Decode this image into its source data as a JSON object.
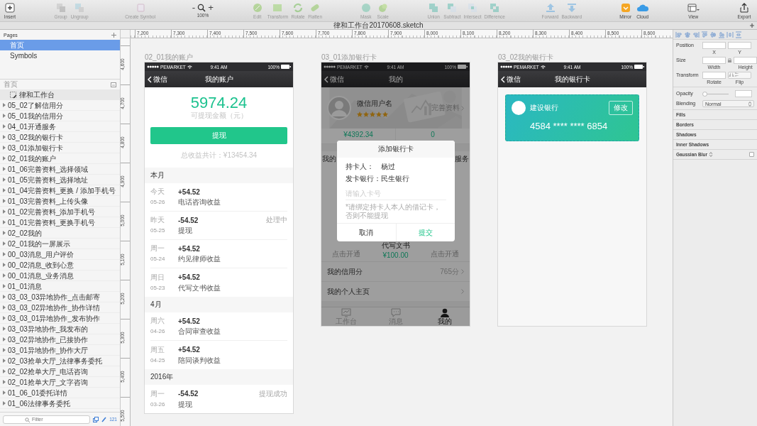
{
  "toolbar": {
    "groups": [
      {
        "items": [
          {
            "kind": "insert",
            "label": "Insert",
            "disabled": false
          }
        ]
      },
      {
        "items": [
          {
            "kind": "group",
            "label": "Group",
            "disabled": true
          },
          {
            "kind": "ungroup",
            "label": "Ungroup",
            "disabled": true
          }
        ]
      },
      {
        "items": [
          {
            "kind": "create-symbol",
            "label": "Create Symbol",
            "disabled": true
          }
        ]
      },
      {
        "items": [
          {
            "kind": "zoom",
            "label": "100%",
            "minus": "-",
            "plus": "+",
            "disabled": false
          }
        ]
      },
      {
        "items": [
          {
            "kind": "edit",
            "label": "Edit",
            "disabled": true
          },
          {
            "kind": "transform",
            "label": "Transform",
            "disabled": true
          },
          {
            "kind": "rotate",
            "label": "Rotate",
            "disabled": true
          },
          {
            "kind": "flatten",
            "label": "Flatten",
            "disabled": true
          }
        ]
      },
      {
        "items": [
          {
            "kind": "mask",
            "label": "Mask",
            "disabled": true
          },
          {
            "kind": "scale",
            "label": "Scale",
            "disabled": true
          }
        ]
      },
      {
        "items": [
          {
            "kind": "union",
            "label": "Union",
            "disabled": true
          },
          {
            "kind": "subtract",
            "label": "Subtract",
            "disabled": true
          },
          {
            "kind": "intersect",
            "label": "Intersect",
            "disabled": true
          },
          {
            "kind": "difference",
            "label": "Difference",
            "disabled": true
          }
        ]
      },
      {
        "items": [
          {
            "kind": "forward",
            "label": "Forward",
            "disabled": true
          },
          {
            "kind": "backward",
            "label": "Backward",
            "disabled": true
          }
        ]
      },
      {
        "items": [
          {
            "kind": "mirror",
            "label": "Mirror",
            "disabled": false
          },
          {
            "kind": "cloud",
            "label": "Cloud",
            "disabled": false
          }
        ]
      },
      {
        "items": [
          {
            "kind": "view",
            "label": "View",
            "disabled": false
          }
        ]
      },
      {
        "items": [
          {
            "kind": "export",
            "label": "Export",
            "disabled": false
          }
        ]
      }
    ]
  },
  "document_title": "律和工作台20170608.sketch",
  "rulers": {
    "horizontal": [
      "7,200",
      "7,300",
      "7,400",
      "7,500",
      "7,600",
      "7,700",
      "7,800",
      "7,900",
      "8,000",
      "8,100",
      "8,200",
      "8,300",
      "8,400",
      "8,500",
      "8,600"
    ],
    "vertical": [
      "4,600",
      "4,700",
      "4,800",
      "4,900",
      "5,000",
      "5,100",
      "5,200",
      "5,300",
      "5,400",
      "5,500"
    ]
  },
  "pages": {
    "title": "Pages",
    "items": [
      {
        "label": "首页",
        "selected": true
      },
      {
        "label": "Symbols",
        "selected": false
      }
    ]
  },
  "layers": {
    "page": "首页",
    "artboard_group": "律和工作台",
    "items": [
      {
        "label": "05_02了解信用分"
      },
      {
        "label": "05_01我的信用分"
      },
      {
        "label": "04_01开通服务"
      },
      {
        "label": "03_02我的银行卡"
      },
      {
        "label": "03_01添加银行卡"
      },
      {
        "label": "02_01我的账户"
      },
      {
        "label": "01_06完善资料_选择领域"
      },
      {
        "label": "01_05完善资料_选择地址"
      },
      {
        "label": "01_04完善资料_更换 / 添加手机号"
      },
      {
        "label": "01_03完善资料_上传头像"
      },
      {
        "label": "01_02完善资料_添加手机号"
      },
      {
        "label": "01_01完善资料_更换手机号"
      },
      {
        "label": "02_02我的"
      },
      {
        "label": "02_01我的一屏展示"
      },
      {
        "label": "00_03消息_用户评价"
      },
      {
        "label": "00_02消息_收到心意"
      },
      {
        "label": "00_01消息_业务消息"
      },
      {
        "label": "01_01消息"
      },
      {
        "label": "03_03_03异地协作_点击邮寄"
      },
      {
        "label": "03_03_02异地协作_协作详情"
      },
      {
        "label": "03_03_01异地协作_发布协作"
      },
      {
        "label": "03_03异地协作_我发布的"
      },
      {
        "label": "03_02异地协作_已接协作"
      },
      {
        "label": "03_01异地协作_协作大厅"
      },
      {
        "label": "02_03抢单大厅_法律事务委托"
      },
      {
        "label": "02_02抢单大厅_电话咨询"
      },
      {
        "label": "02_01抢单大厅_文字咨询"
      },
      {
        "label": "01_06_01委托详情"
      },
      {
        "label": "01_06法律事务委托"
      }
    ],
    "filter_placeholder": "Filter",
    "count": "121"
  },
  "artboards": [
    {
      "kind": "account",
      "label": "02_01我的账户",
      "status": {
        "carrier": "PEMARKET",
        "time": "9:41 AM",
        "battery": "100%"
      },
      "nav": {
        "back": "微信",
        "title": "我的账户"
      },
      "balance": "5974.24",
      "balance_caption": "可提现金额（元）",
      "withdraw_button": "提现",
      "total": "总收益共计：¥13454.34",
      "sections": [
        {
          "title": "本月",
          "rows": [
            {
              "day": "今天",
              "date": "05-26",
              "amount": "+54.52",
              "desc": "电话咨询收益"
            },
            {
              "day": "昨天",
              "date": "05-25",
              "amount": "-54.52",
              "desc": "提现",
              "status": "处理中"
            },
            {
              "day": "周一",
              "date": "05-24",
              "amount": "+54.52",
              "desc": "约见律师收益"
            },
            {
              "day": "周日",
              "date": "05-23",
              "amount": "+54.52",
              "desc": "代写文书收益"
            }
          ]
        },
        {
          "title": "4月",
          "rows": [
            {
              "day": "周六",
              "date": "04-26",
              "amount": "+54.52",
              "desc": "合同审查收益"
            },
            {
              "day": "周五",
              "date": "04-25",
              "amount": "+54.52",
              "desc": "陪同谈判收益"
            }
          ]
        },
        {
          "title": "2016年",
          "rows": [
            {
              "day": "周一",
              "date": "03-26",
              "amount": "-54.52",
              "desc": "提现",
              "status": "提现成功"
            }
          ]
        }
      ]
    },
    {
      "kind": "profile_dialog",
      "label": "03_01添加银行卡",
      "status": {
        "carrier": "PEMARKET",
        "time": "9:41 AM",
        "battery": "100%"
      },
      "nav": {
        "back": "微信",
        "title": "我的"
      },
      "user_name": "微信用户名",
      "stars": 5,
      "profile_link": "完善资料",
      "balance": "¥4392.34",
      "count": "0",
      "section_left": "我的",
      "section_right": "服务",
      "services": [
        {
          "sub": "点击开通"
        },
        {
          "name": "代写文书",
          "sub": "¥100.00"
        },
        {
          "sub": "点击开通"
        }
      ],
      "rows": [
        {
          "label": "我的信用分",
          "value": "765分"
        },
        {
          "label": "我的个人主页"
        }
      ],
      "tabs": [
        {
          "kind": "monitor",
          "label": "工作台",
          "selected": false
        },
        {
          "kind": "chat",
          "label": "消息",
          "selected": false
        },
        {
          "kind": "person",
          "label": "我的",
          "selected": true
        }
      ],
      "dialog": {
        "title": "添加银行卡",
        "fields": [
          {
            "label": "持卡人：",
            "value": "杨过"
          },
          {
            "label": "发卡银行：",
            "value": "民生银行"
          }
        ],
        "placeholder": "请输入卡号",
        "note": "*请绑定持卡人本人的借记卡，否则不能提现",
        "buttons": [
          {
            "kind": "cancel",
            "label": "取消"
          },
          {
            "kind": "primary",
            "label": "提交"
          }
        ]
      }
    },
    {
      "kind": "bank_cards",
      "label": "03_02我的银行卡",
      "status": {
        "carrier": "PEMARKET",
        "time": "9:41 AM",
        "battery": "100%"
      },
      "nav": {
        "back": "微信",
        "title": "我的银行卡"
      },
      "cards": [
        {
          "bank": "建设银行",
          "edit": "修改",
          "number": "4584 **** **** 6854",
          "selected": true
        }
      ]
    }
  ],
  "inspector": {
    "position": {
      "label": "Position",
      "captions": [
        "X",
        "Y"
      ]
    },
    "size": {
      "label": "Size",
      "captions": [
        "Width",
        "Height"
      ]
    },
    "transform": {
      "label": "Transform",
      "rotate_caption": "Rotate",
      "flip_caption": "Flip"
    },
    "opacity": {
      "label": "Opacity",
      "level": 0
    },
    "blending": {
      "label": "Blending",
      "value": "Normal"
    },
    "sections": [
      {
        "title": "Fills"
      },
      {
        "title": "Borders"
      },
      {
        "title": "Shadows"
      },
      {
        "title": "Inner Shadows"
      }
    ],
    "gaussian_blur": {
      "title": "Gaussian Blur",
      "checked": false
    }
  }
}
